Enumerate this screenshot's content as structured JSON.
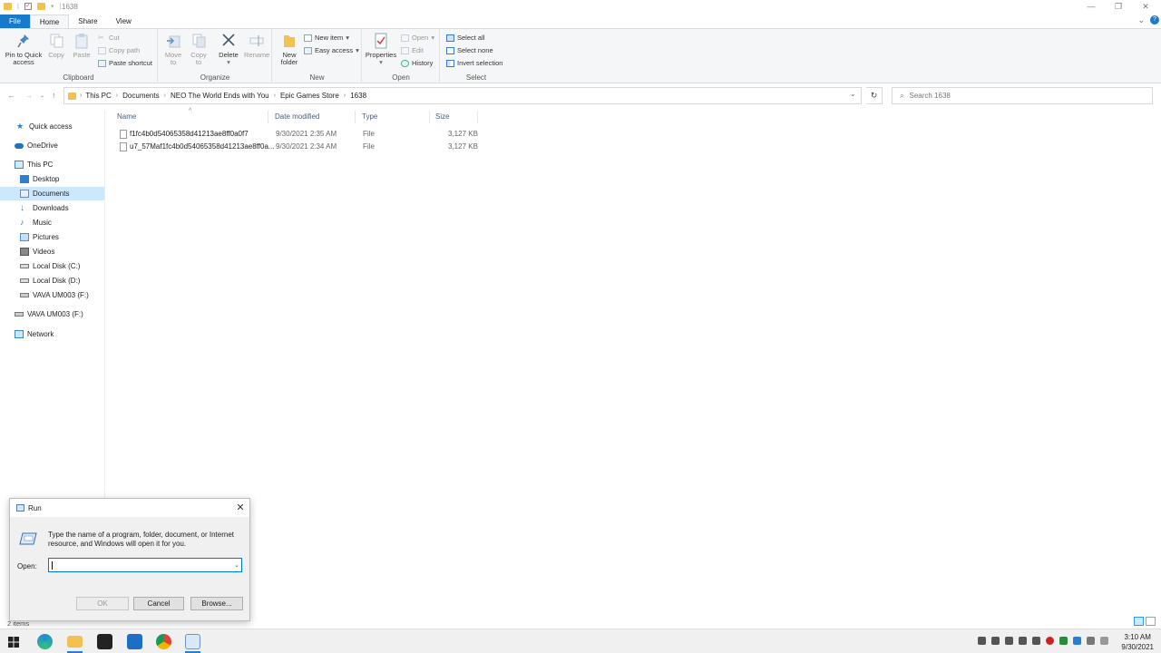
{
  "window": {
    "title": "1638"
  },
  "ribbon_tabs": [
    {
      "label": "File"
    },
    {
      "label": "Home"
    },
    {
      "label": "Share"
    },
    {
      "label": "View"
    }
  ],
  "clipboard": {
    "group_label": "Clipboard",
    "pin_label_1": "Pin to Quick",
    "pin_label_2": "access",
    "copy_label": "Copy",
    "paste_label": "Paste",
    "cut_label": "Cut",
    "copy_path_label": "Copy path",
    "paste_shortcut_label": "Paste shortcut"
  },
  "organize": {
    "group_label": "Organize",
    "move_label_1": "Move",
    "move_label_2": "to",
    "copy_label_1": "Copy",
    "copy_label_2": "to",
    "delete_label": "Delete",
    "rename_label": "Rename"
  },
  "new": {
    "group_label": "New",
    "new_folder_1": "New",
    "new_folder_2": "folder",
    "new_item_label": "New item",
    "easy_access_label": "Easy access"
  },
  "open": {
    "group_label": "Open",
    "properties_label": "Properties",
    "open_label": "Open",
    "edit_label": "Edit",
    "history_label": "History"
  },
  "select": {
    "group_label": "Select",
    "select_all_label": "Select all",
    "select_none_label": "Select none",
    "invert_label": "Invert selection"
  },
  "address": {
    "crumbs": [
      "This PC",
      "Documents",
      "NEO The World Ends with You",
      "Epic Games Store",
      "1638"
    ],
    "search_placeholder": "Search 1638"
  },
  "nav_pane": {
    "quick_access": "Quick access",
    "onedrive": "OneDrive",
    "this_pc": "This PC",
    "desktop": "Desktop",
    "documents": "Documents",
    "downloads": "Downloads",
    "music": "Music",
    "pictures": "Pictures",
    "videos": "Videos",
    "local_c": "Local Disk (C:)",
    "local_d": "Local Disk (D:)",
    "vava_f_sub": "VAVA UM003  (F:)",
    "vava_f": "VAVA UM003  (F:)",
    "network": "Network"
  },
  "columns": {
    "name": "Name",
    "date": "Date modified",
    "type": "Type",
    "size": "Size"
  },
  "files": [
    {
      "name": "f1fc4b0d54065358d41213ae8ff0a0f7",
      "date": "9/30/2021 2:35 AM",
      "type": "File",
      "size": "3,127 KB"
    },
    {
      "name": "u7_57Maf1fc4b0d54065358d41213ae8ff0a...",
      "date": "9/30/2021 2:34 AM",
      "type": "File",
      "size": "3,127 KB"
    }
  ],
  "run_dialog": {
    "title": "Run",
    "description": "Type the name of a program, folder, document, or Internet resource, and Windows will open it for you.",
    "open_label": "Open:",
    "value": "",
    "ok_label": "OK",
    "cancel_label": "Cancel",
    "browse_label": "Browse..."
  },
  "status": {
    "items_count": "2 items"
  },
  "clock": {
    "time": "3:10 AM",
    "date": "9/30/2021"
  }
}
